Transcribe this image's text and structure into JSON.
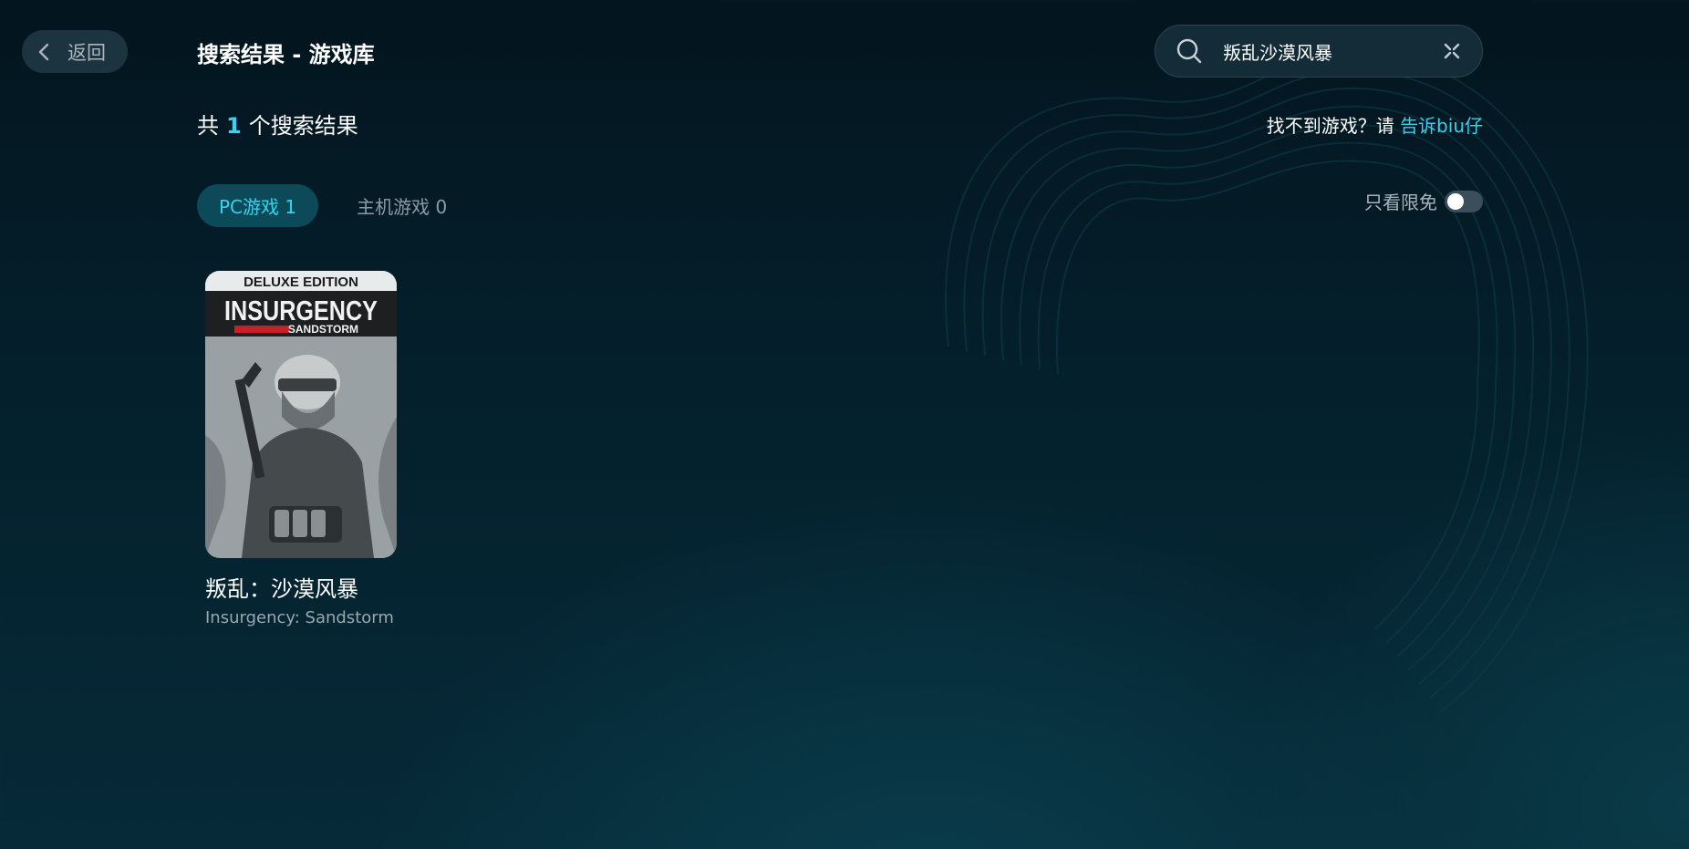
{
  "header": {
    "back_label": "返回",
    "page_title": "搜索结果 - 游戏库"
  },
  "search": {
    "value": "叛乱沙漠风暴",
    "placeholder": ""
  },
  "results": {
    "prefix": "共",
    "count": "1",
    "suffix": "个搜索结果"
  },
  "feedback": {
    "text": "找不到游戏？请",
    "link": "告诉biu仔"
  },
  "tabs": [
    {
      "label": "PC游戏 1",
      "active": true
    },
    {
      "label": "主机游戏 0",
      "active": false
    }
  ],
  "filter": {
    "free_only_label": "只看限免",
    "free_only_on": false
  },
  "games": [
    {
      "title_cn": "叛乱：沙漠风暴",
      "title_en": "Insurgency: Sandstorm",
      "cover_edition": "DELUXE EDITION",
      "cover_title": "INSURGENCY",
      "cover_subtitle": "SANDSTORM"
    }
  ],
  "colors": {
    "accent": "#33d4ef",
    "background": "#041f2b",
    "tab_active_bg": "#0c4a5a"
  },
  "icons": {
    "back": "chevron-left-icon",
    "search": "search-icon",
    "clear": "clear-icon"
  }
}
